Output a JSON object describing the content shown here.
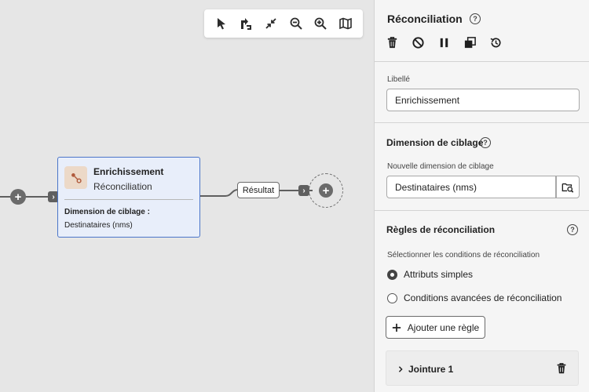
{
  "toolbar": {
    "icons": [
      "pointer-icon",
      "rotate-icon",
      "collapse-icon",
      "zoom-out-icon",
      "zoom-in-icon",
      "map-icon"
    ]
  },
  "node": {
    "title": "Enrichissement",
    "subtitle": "Réconciliation",
    "dimension_label": "Dimension de ciblage :",
    "dimension_value": "Destinataires (nms)"
  },
  "canvas": {
    "result_label": "Résultat"
  },
  "panel": {
    "title": "Réconciliation",
    "libelle_label": "Libellé",
    "libelle_value": "Enrichissement",
    "dimension_section_title": "Dimension de ciblage",
    "new_dimension_label": "Nouvelle dimension de ciblage",
    "new_dimension_value": "Destinataires (nms)",
    "rules_section_title": "Règles de réconciliation",
    "rules_instruction": "Sélectionner les conditions de réconciliation",
    "radio_simple": "Attributs simples",
    "radio_advanced": "Conditions avancées de réconciliation",
    "selected_radio": "Attributs simples",
    "add_rule_label": "Ajouter une règle",
    "join_label": "Jointure 1"
  },
  "colors": {
    "node_border": "#4b75c9",
    "node_bg": "#e8eefa",
    "icon_bg": "#ecd9c8",
    "icon_accent": "#b05a3c"
  }
}
